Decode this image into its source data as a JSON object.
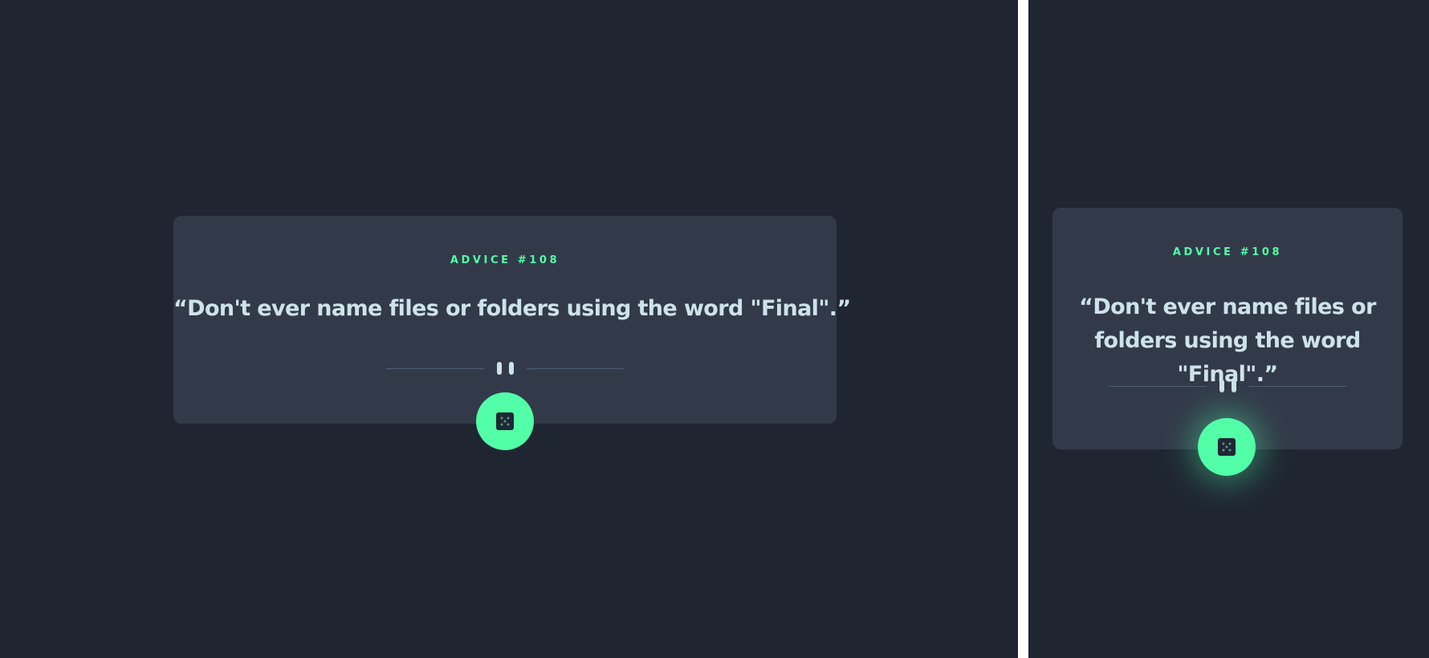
{
  "colors": {
    "page_background": "#1f2632",
    "card_background": "#323a49",
    "accent": "#52ffa8",
    "quote_text": "#cee3e9",
    "divider_line": "#4f5d74",
    "separator": "#ffffff"
  },
  "desktop": {
    "advice_label": "ADVICE #108",
    "quote": "“Don't ever name files or folders using the word \"Final\".”",
    "divider_icon": "pause-icon",
    "button_icon": "dice-icon"
  },
  "mobile": {
    "advice_label": "ADVICE #108",
    "quote": "“Don't ever name files or folders using the word \"Final\".”",
    "divider_icon": "pause-icon",
    "button_icon": "dice-icon"
  }
}
